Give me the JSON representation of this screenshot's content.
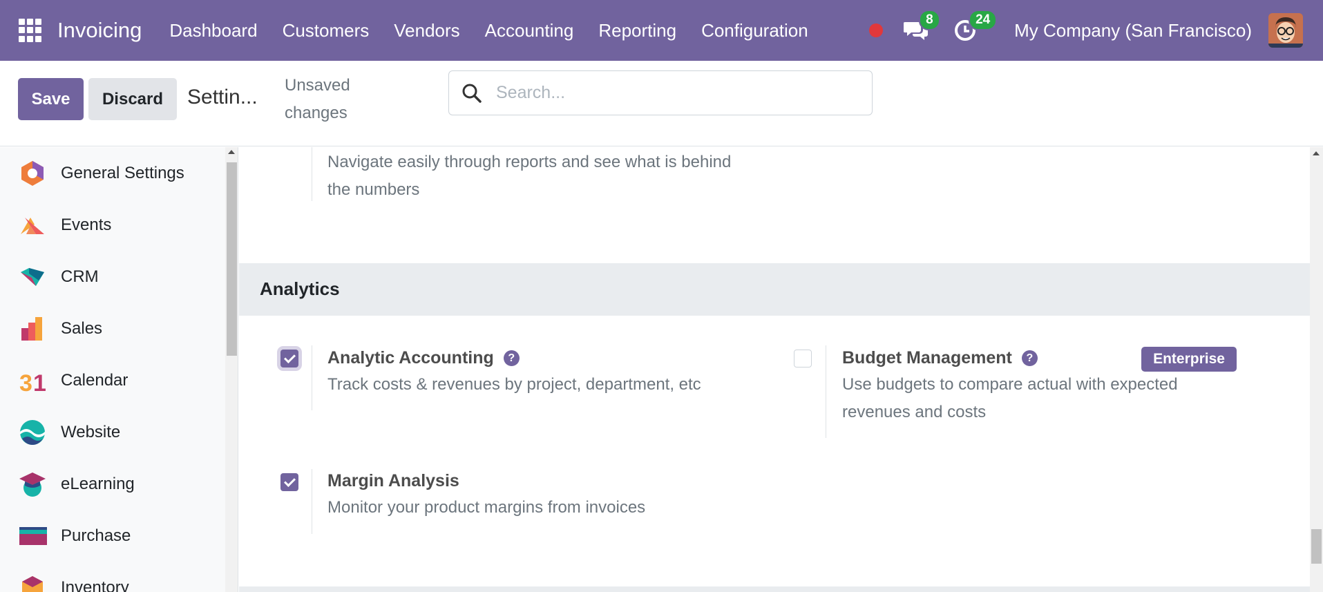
{
  "navbar": {
    "brand": "Invoicing",
    "menu": [
      "Dashboard",
      "Customers",
      "Vendors",
      "Accounting",
      "Reporting",
      "Configuration"
    ],
    "messages_count": "8",
    "activities_count": "24",
    "company": "My Company (San Francisco)",
    "accent_color": "#71639e"
  },
  "control": {
    "save_label": "Save",
    "discard_label": "Discard",
    "breadcrumb": "Settin...",
    "unsaved": "Unsaved changes",
    "search_placeholder": "Search..."
  },
  "sidebar": {
    "items": [
      {
        "label": "General Settings",
        "icon": "general-settings-icon"
      },
      {
        "label": "Events",
        "icon": "events-icon"
      },
      {
        "label": "CRM",
        "icon": "crm-icon"
      },
      {
        "label": "Sales",
        "icon": "sales-icon"
      },
      {
        "label": "Calendar",
        "icon": "calendar-icon"
      },
      {
        "label": "Website",
        "icon": "website-icon"
      },
      {
        "label": "eLearning",
        "icon": "elearning-icon"
      },
      {
        "label": "Purchase",
        "icon": "purchase-icon"
      },
      {
        "label": "Inventory",
        "icon": "inventory-icon"
      }
    ]
  },
  "main": {
    "top_description": "Navigate easily through reports and see what is behind the numbers",
    "section_title": "Analytics",
    "settings": {
      "analytic": {
        "title": "Analytic Accounting",
        "description": "Track costs & revenues by project, department, etc",
        "checked": true
      },
      "budget": {
        "title": "Budget Management",
        "description": "Use budgets to compare actual with expected revenues and costs",
        "checked": false,
        "badge": "Enterprise"
      },
      "margin": {
        "title": "Margin Analysis",
        "description": "Monitor your product margins from invoices",
        "checked": true
      }
    }
  }
}
